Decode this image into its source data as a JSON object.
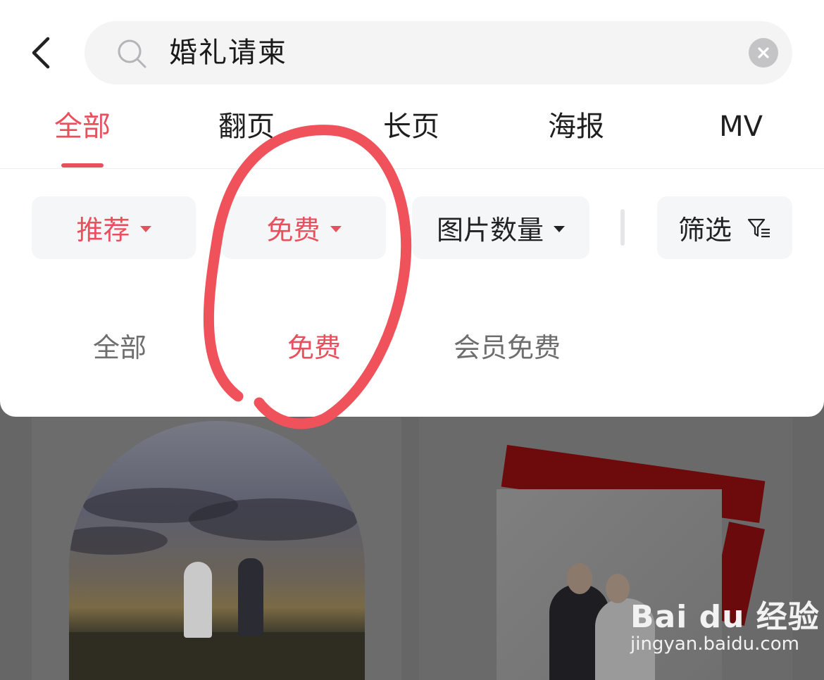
{
  "search": {
    "query": "婚礼请柬"
  },
  "tabs": [
    {
      "label": "全部",
      "active": true
    },
    {
      "label": "翻页",
      "active": false
    },
    {
      "label": "长页",
      "active": false
    },
    {
      "label": "海报",
      "active": false
    },
    {
      "label": "MV",
      "active": false
    }
  ],
  "filters": {
    "sort": "推荐",
    "price": "免费",
    "image_count": "图片数量",
    "filter": "筛选"
  },
  "price_options": [
    {
      "label": "全部",
      "selected": false
    },
    {
      "label": "免费",
      "selected": true
    },
    {
      "label": "会员免费",
      "selected": false
    }
  ],
  "watermark": {
    "logo_text": "Bai du 经验",
    "url": "jingyan.baidu.com"
  },
  "colors": {
    "accent": "#e9505e",
    "annotation": "#f0525b"
  }
}
